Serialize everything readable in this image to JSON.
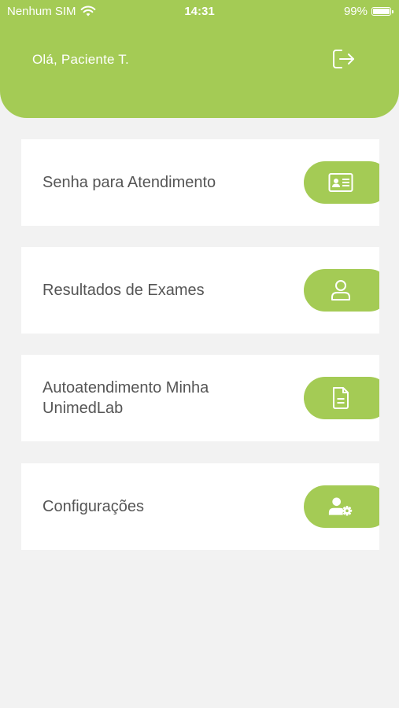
{
  "status_bar": {
    "carrier": "Nenhum SIM",
    "time": "14:31",
    "battery": "99%",
    "battery_level": 0.99
  },
  "header": {
    "greeting": "Olá, Paciente T.",
    "logout_icon": "logout-icon"
  },
  "menu": {
    "items": [
      {
        "label": "Senha para Atendimento",
        "icon": "id-card-icon"
      },
      {
        "label": "Resultados de Exames",
        "icon": "user-icon"
      },
      {
        "label": "Autoatendimento Minha UnimedLab",
        "icon": "document-icon"
      },
      {
        "label": "Configurações",
        "icon": "user-settings-icon"
      }
    ]
  },
  "colors": {
    "accent": "#a4cb55",
    "background": "#f2f2f2",
    "card": "#ffffff",
    "text": "#555555"
  }
}
